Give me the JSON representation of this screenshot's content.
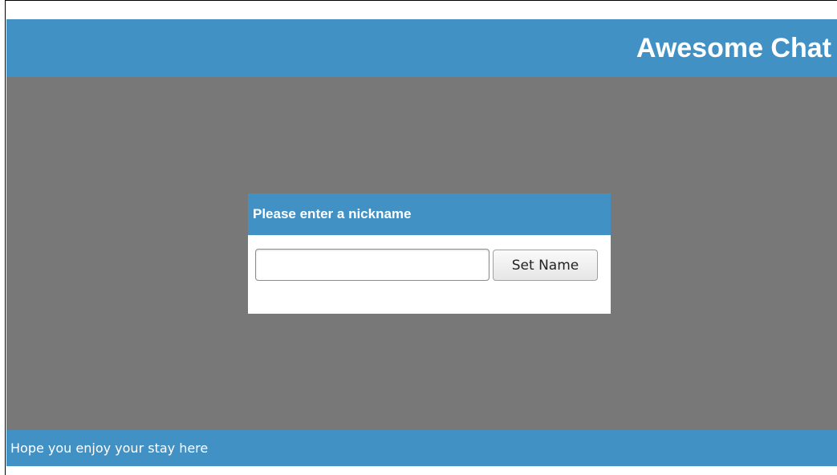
{
  "header": {
    "title": "Awesome Chat"
  },
  "dialog": {
    "title": "Please enter a nickname",
    "input_value": "",
    "input_placeholder": "",
    "button_label": "Set Name"
  },
  "footer": {
    "text": "Hope you enjoy your stay here"
  },
  "colors": {
    "accent": "#4291c4",
    "overlay": "#787878",
    "background": "#ffffff"
  }
}
